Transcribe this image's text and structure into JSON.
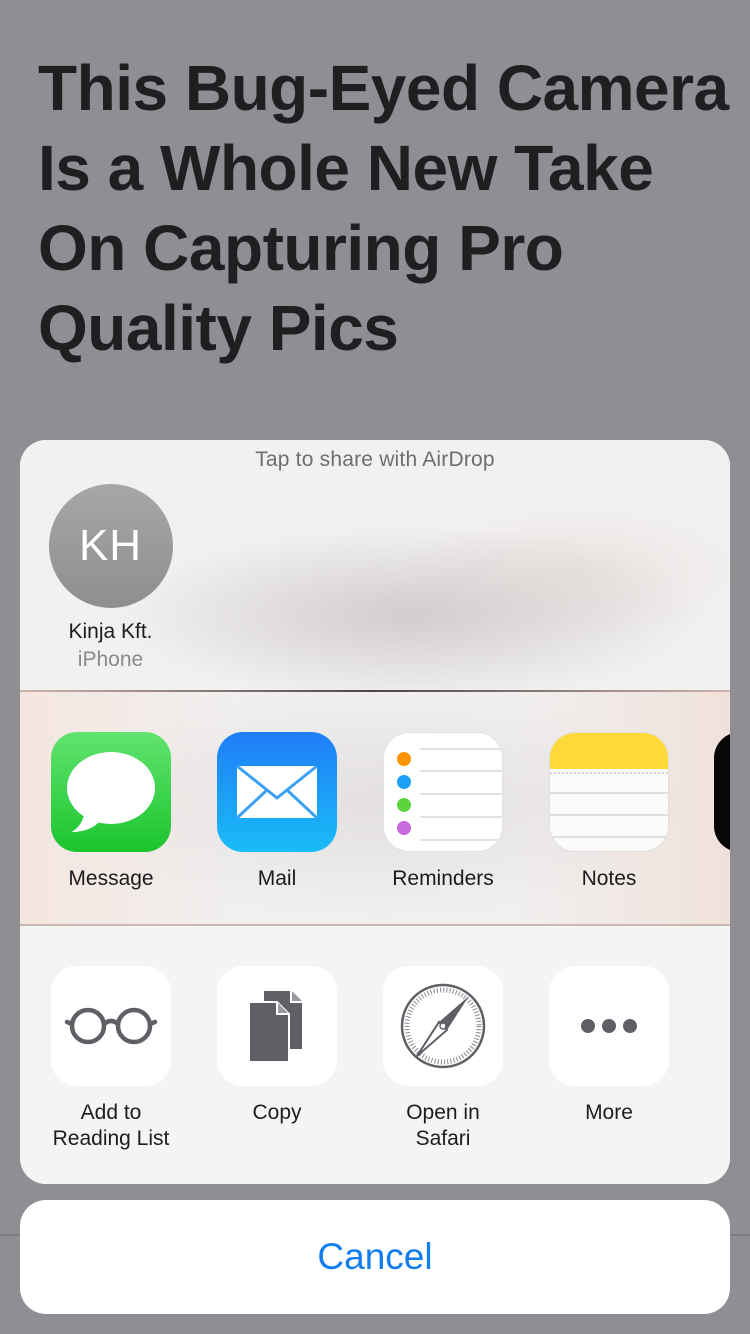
{
  "article": {
    "title": "This Bug-Eyed Camera Is a Whole New Take On Capturing Pro Quality Pics"
  },
  "airdrop": {
    "hint": "Tap to share with AirDrop",
    "contact": {
      "initials": "KH",
      "name": "Kinja Kft.",
      "device": "iPhone"
    }
  },
  "share_apps": [
    {
      "label": "Message",
      "icon": "message-bubble-icon",
      "color": "#1bc42d"
    },
    {
      "label": "Mail",
      "icon": "envelope-icon",
      "color": "#1f7df6"
    },
    {
      "label": "Reminders",
      "icon": "reminders-icon",
      "colors": [
        "#ff9500",
        "#1ba1f5",
        "#5dd33f",
        "#c969e0"
      ]
    },
    {
      "label": "Notes",
      "icon": "notes-icon",
      "color": "#fedb3a"
    }
  ],
  "actions": [
    {
      "label": "Add to\nReading List",
      "icon": "glasses-icon"
    },
    {
      "label": "Copy",
      "icon": "copy-documents-icon"
    },
    {
      "label": "Open in\nSafari",
      "icon": "compass-icon"
    },
    {
      "label": "More",
      "icon": "more-dots-icon"
    }
  ],
  "cancel_label": "Cancel",
  "colors": {
    "accent": "#127dec",
    "backdrop": "#8e8e93",
    "sheet": "#f3f3f4"
  }
}
